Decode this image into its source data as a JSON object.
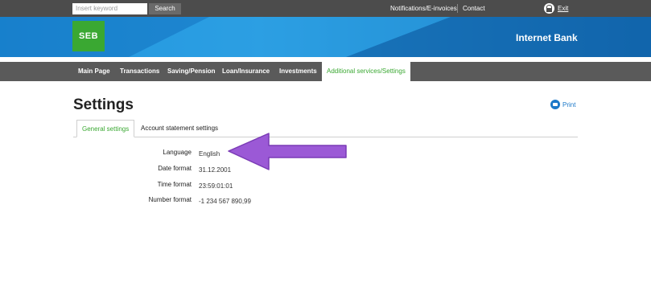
{
  "topbar": {
    "search_placeholder": "Insert keyword",
    "search_button": "Search",
    "links": [
      "Notifications/E-invoices",
      "Contact"
    ],
    "exit_label": "Exit"
  },
  "banner": {
    "logo": "SEB",
    "title": "Internet Bank"
  },
  "nav": {
    "items": [
      "Main Page",
      "Transactions",
      "Saving/Pension",
      "Loan/Insurance",
      "Investments",
      "Additional services/Settings"
    ],
    "active_index": 5
  },
  "page": {
    "title": "Settings",
    "print_label": "Print"
  },
  "tabs": [
    "General settings",
    "Account statement settings"
  ],
  "settings": [
    {
      "label": "Language",
      "value": "English"
    },
    {
      "label": "Date format",
      "value": "31.12.2001"
    },
    {
      "label": "Time format",
      "value": "23:59:01:01"
    },
    {
      "label": "Number format",
      "value": "-1 234 567 890,99"
    }
  ],
  "colors": {
    "accent_green": "#3aa832",
    "banner_blue": "#1a8cd8",
    "topbar_gray": "#4c4c4c",
    "nav_gray": "#5a5a5a",
    "arrow_purple": "#9b59d6"
  }
}
